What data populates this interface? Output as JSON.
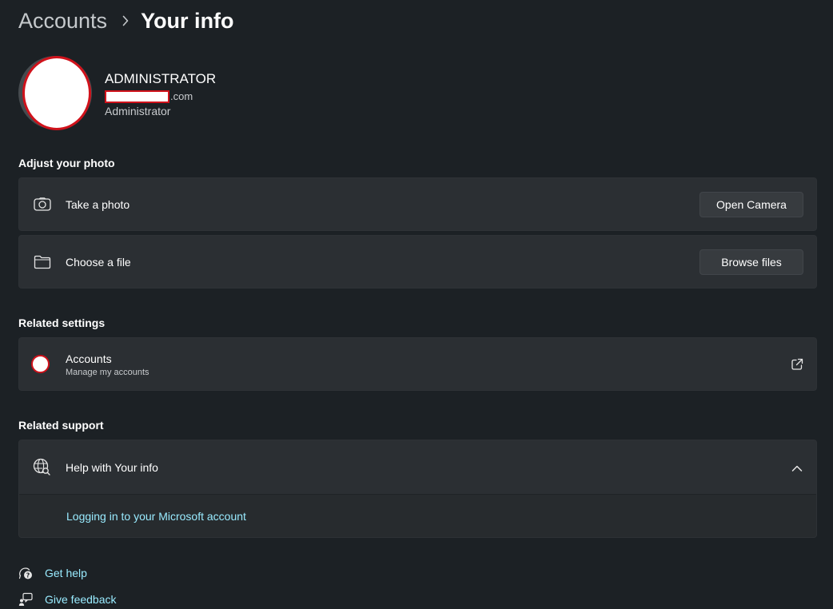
{
  "breadcrumb": {
    "parent": "Accounts",
    "current": "Your info"
  },
  "profile": {
    "name": "ADMINISTRATOR",
    "email_suffix": ".com",
    "role": "Administrator"
  },
  "adjust_photo": {
    "heading": "Adjust your photo",
    "take_photo": {
      "label": "Take a photo",
      "button": "Open Camera",
      "icon": "camera-icon"
    },
    "choose_file": {
      "label": "Choose a file",
      "button": "Browse files",
      "icon": "folder-icon"
    }
  },
  "related_settings": {
    "heading": "Related settings",
    "accounts": {
      "title": "Accounts",
      "subtitle": "Manage my accounts",
      "icon": "external-link-icon"
    }
  },
  "related_support": {
    "heading": "Related support",
    "help": {
      "title": "Help with Your info",
      "icon": "globe-search-icon",
      "expanded": true,
      "links": [
        "Logging in to your Microsoft account"
      ]
    }
  },
  "footer": {
    "get_help": "Get help",
    "give_feedback": "Give feedback"
  },
  "colors": {
    "background": "#1c2125",
    "card": "#2b2f33",
    "link": "#99ebff",
    "redaction_border": "#d0121b"
  }
}
